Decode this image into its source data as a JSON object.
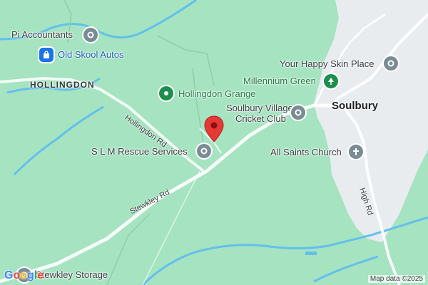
{
  "map": {
    "places": {
      "hollingdon": "HOLLINGDON",
      "soulbury": "Soulbury"
    },
    "pois": [
      {
        "name": "Pi Accountants",
        "icon": "pin-gray-icon"
      },
      {
        "name": "Old Skool Autos",
        "icon": "shopping-bag-icon"
      },
      {
        "name": "Hollingdon Grange",
        "icon": "green-dot-icon"
      },
      {
        "name": "S L M Rescue Services",
        "icon": "pin-gray-icon"
      },
      {
        "name": "Soulbury Village Cricket Club",
        "line1": "Soulbury Village",
        "line2": "Cricket Club",
        "icon": "pin-gray-icon"
      },
      {
        "name": "Your Happy Skin Place",
        "icon": "pin-gray-icon"
      },
      {
        "name": "Millennium Green",
        "icon": "tree-icon"
      },
      {
        "name": "All Saints Church",
        "icon": "cross-icon"
      },
      {
        "name": "Stewkley Storage",
        "display": "Stewkley Storage",
        "icon": "pin-gray-icon"
      }
    ],
    "roads": {
      "hollingdon_rd": "Hollingdon Rd",
      "stewkley_rd": "Stewkley Rd",
      "high_rd": "High Rd"
    },
    "attribution": "Map data ©2025",
    "logo": "Google",
    "colors": {
      "land": "#a6e3c0",
      "village": "#e9eef0",
      "water": "#6cc4f2",
      "road": "#ffffff",
      "marker": "#e53935"
    }
  }
}
